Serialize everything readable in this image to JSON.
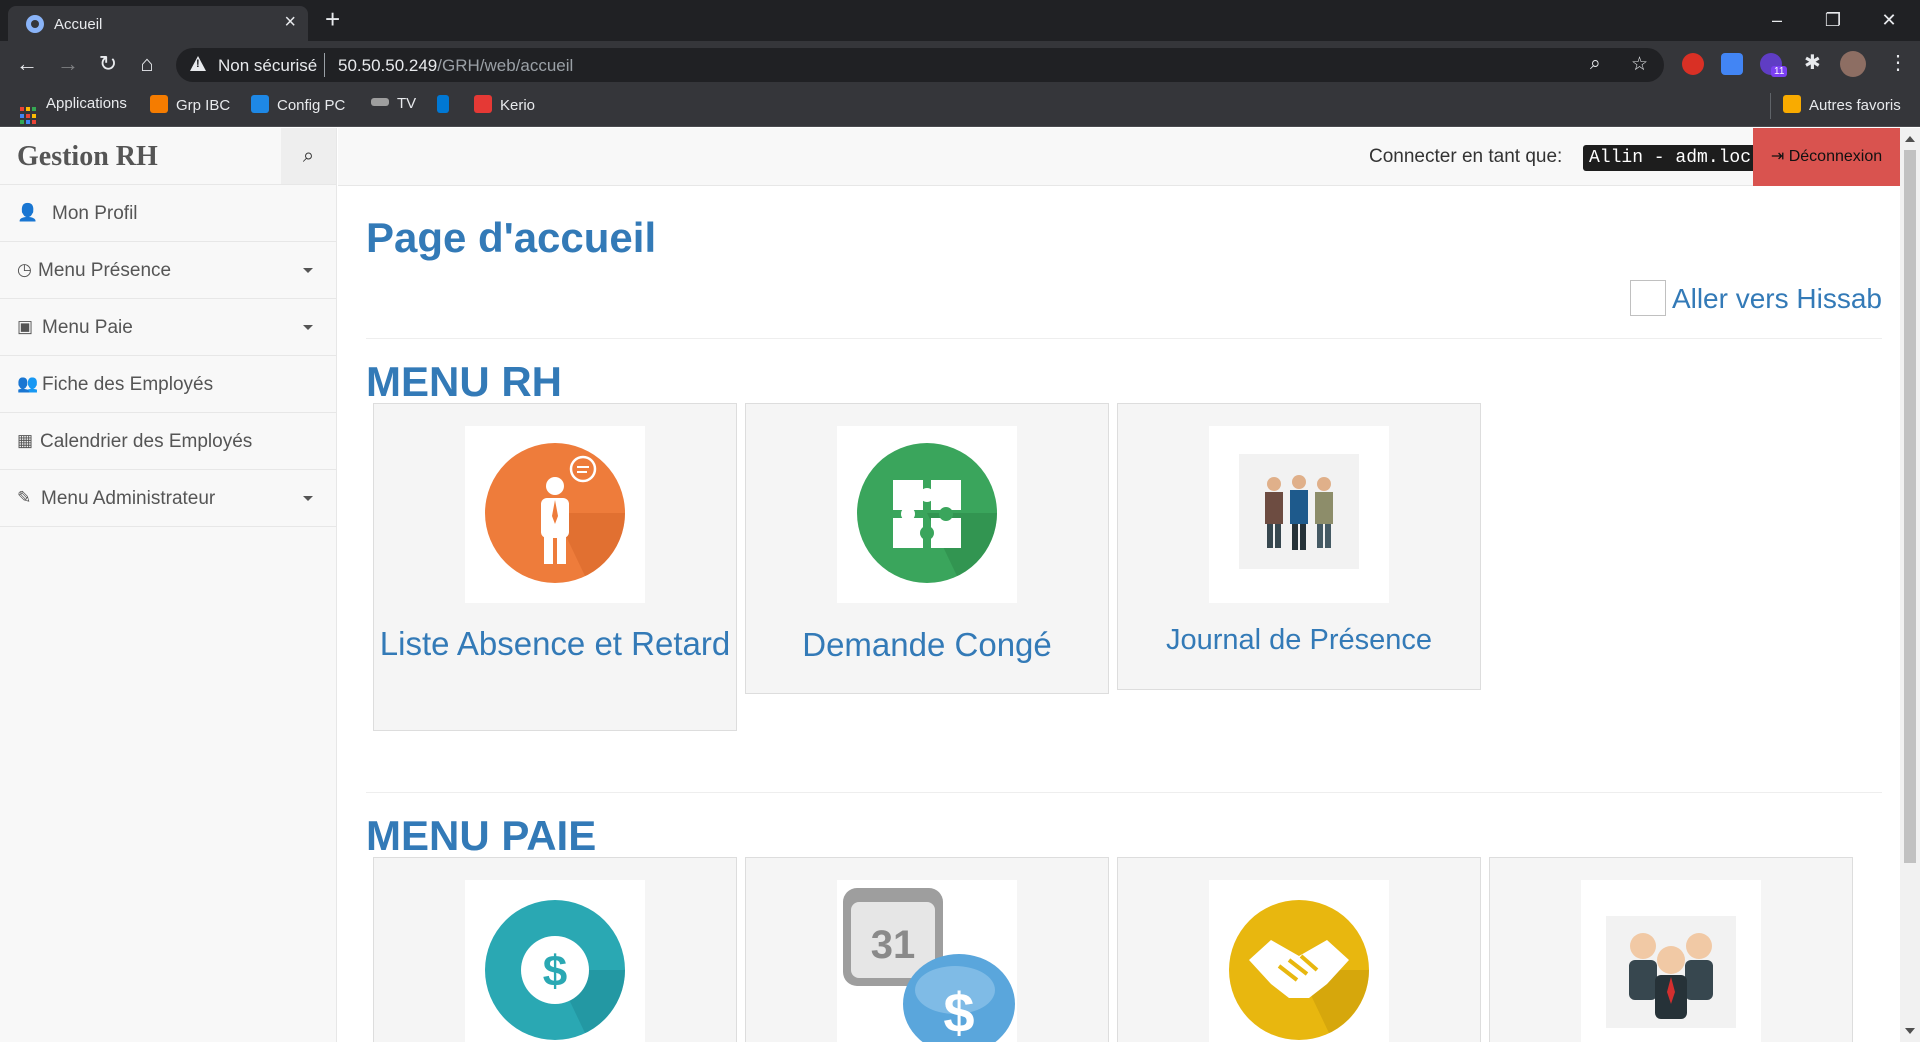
{
  "browser": {
    "tab_title": "Accueil",
    "new_tab": "+",
    "security_label": "Non sécurisé",
    "url_host": "50.50.50.249",
    "url_path": "/GRH/web/accueil",
    "bookmarks": [
      "Applications",
      "Grp IBC",
      "Config PC",
      "TV",
      "Kerio"
    ],
    "other_bookmarks": "Autres favoris",
    "extension_badge": "11"
  },
  "app": {
    "brand": "Gestion RH",
    "connected_label": "Connecter en tant que:",
    "connected_user": "Allin - adm.loc",
    "logout_label": "Déconnexion"
  },
  "sidebar": {
    "items": [
      {
        "label": "Mon Profil",
        "icon": "user-icon"
      },
      {
        "label": "Menu Présence",
        "icon": "clock-icon"
      },
      {
        "label": "Menu Paie",
        "icon": "money-icon"
      },
      {
        "label": "Fiche des Employés",
        "icon": "users-icon"
      },
      {
        "label": "Calendrier des Employés",
        "icon": "calendar-icon"
      },
      {
        "label": "Menu Administrateur",
        "icon": "edit-icon"
      }
    ]
  },
  "main": {
    "page_title": "Page d'accueil",
    "hissab_link": "Aller vers Hissab",
    "menu_rh": {
      "title": "MENU RH",
      "cards": [
        {
          "label": "Liste Absence et Retard",
          "icon": "employee-icon"
        },
        {
          "label": "Demande Congé",
          "icon": "puzzle-icon"
        },
        {
          "label": "Journal de Présence",
          "icon": "team-icon"
        }
      ]
    },
    "menu_paie": {
      "title": "MENU PAIE",
      "cards": [
        {
          "icon": "dollar-icon"
        },
        {
          "icon": "calendar-dollar-icon",
          "day": "31"
        },
        {
          "icon": "handshake-icon"
        },
        {
          "icon": "managers-icon"
        }
      ]
    }
  },
  "colors": {
    "link": "#337ab7",
    "logout": "#d9534f"
  }
}
